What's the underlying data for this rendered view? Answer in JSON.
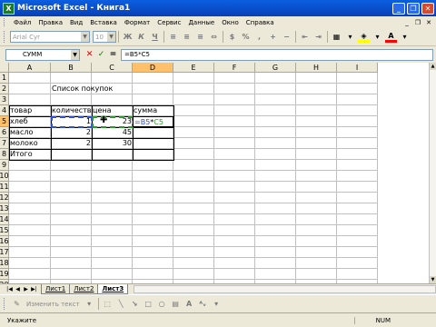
{
  "window": {
    "title": "Microsoft Excel - Книга1",
    "icon": "excel-icon"
  },
  "menu": [
    "Файл",
    "Правка",
    "Вид",
    "Вставка",
    "Формат",
    "Сервис",
    "Данные",
    "Окно",
    "Справка"
  ],
  "toolbar": {
    "font_name": "Arial Cyr",
    "font_size": "10"
  },
  "formula_bar": {
    "name_box": "СУММ",
    "cancel": "✕",
    "enter": "✓",
    "fx": "=",
    "formula": "=B5*C5"
  },
  "columns": [
    "A",
    "B",
    "C",
    "D",
    "E",
    "F",
    "G",
    "H",
    "I"
  ],
  "rows": [
    "1",
    "2",
    "3",
    "4",
    "5",
    "6",
    "7",
    "8",
    "9",
    "10",
    "11",
    "12",
    "13",
    "14",
    "15",
    "16",
    "17",
    "18",
    "19",
    "20"
  ],
  "cells": {
    "b2": "Список покупок",
    "a4": "товар",
    "b4": "количество",
    "c4": "цена",
    "d4": "сумма",
    "a5": "хлеб",
    "b5": "1",
    "c5": "23",
    "d5_b": "=B5",
    "d5_op": "*",
    "d5_c": "C5",
    "a6": "масло",
    "b6": "2",
    "c6": "45",
    "a7": "молоко",
    "b7": "2",
    "c7": "30",
    "a8": "Итого"
  },
  "sheets": [
    "Лист1",
    "Лист2",
    "Лист3"
  ],
  "active_sheet": "Лист3",
  "drawing": {
    "label": "Изменить текст"
  },
  "status": {
    "mode": "Укажите",
    "num": "NUM"
  }
}
